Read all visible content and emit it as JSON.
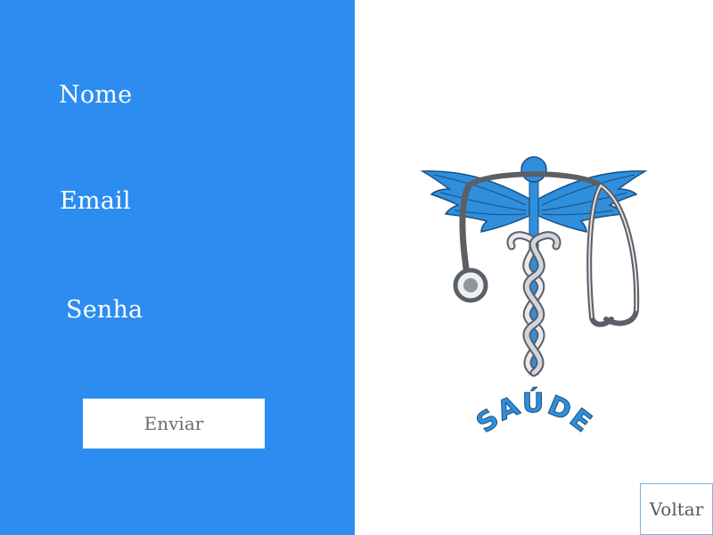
{
  "form": {
    "labels": {
      "name": "Nome",
      "email": "Email",
      "password": "Senha"
    },
    "submit_label": "Enviar"
  },
  "logo": {
    "text": "SAÚDE",
    "icon": "caduceus-stethoscope-icon"
  },
  "nav": {
    "back_label": "Voltar"
  },
  "colors": {
    "left_panel": "#2d8cf0",
    "logo_blue": "#2f8fdc",
    "label_text": "#ffffff",
    "button_text": "#6b6b6b"
  }
}
